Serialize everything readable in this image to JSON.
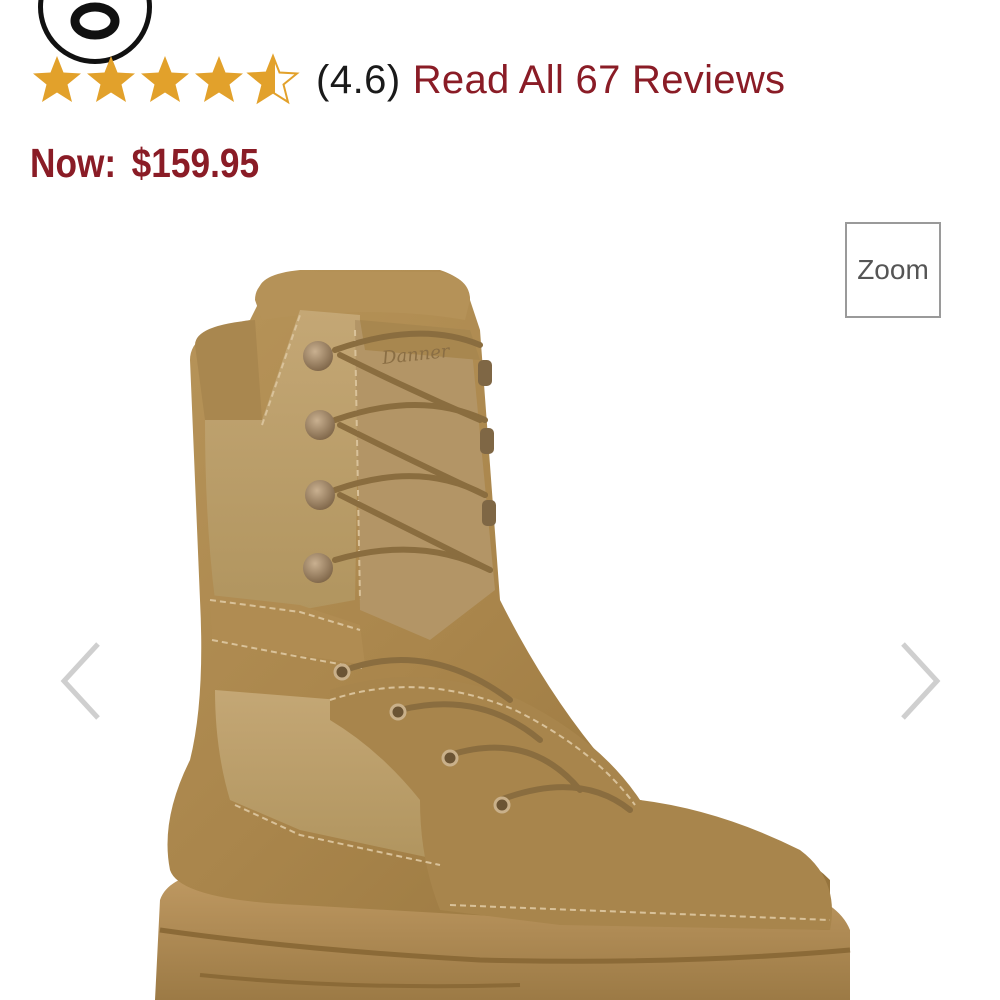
{
  "brand_badge": {
    "icon": "brand-logo-badge-icon"
  },
  "rating": {
    "stars_value": 4.6,
    "stars_max": 5,
    "value_text": "(4.6)",
    "reviews_link": "Read All 67 Reviews",
    "star_color": "#e2a12b"
  },
  "price": {
    "label": "Now:",
    "value": "$159.95",
    "color": "#8a1c26"
  },
  "gallery": {
    "zoom_label": "Zoom",
    "prev_icon": "chevron-left-icon",
    "next_icon": "chevron-right-icon",
    "image_icon": "tan-combat-boot-product-image",
    "boot_logo_text": "Danner"
  }
}
